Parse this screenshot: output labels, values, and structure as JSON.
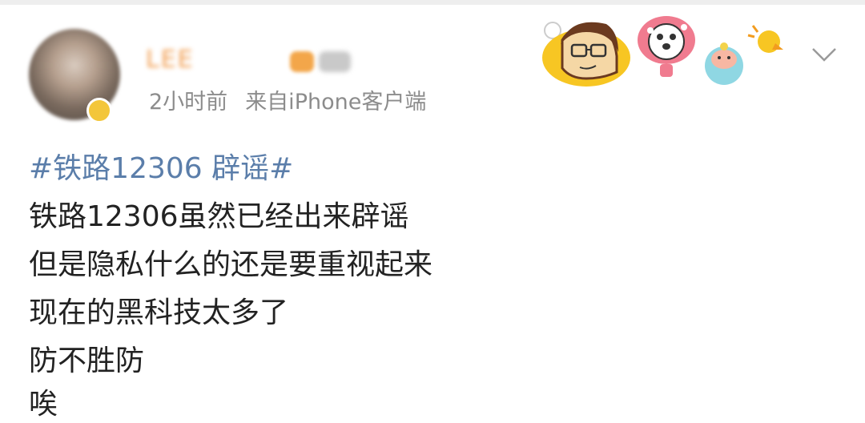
{
  "post": {
    "username": "LEE",
    "time": "2小时前",
    "source": "来自iPhone客户端",
    "topic": "#铁路12306 辟谣#",
    "lines": [
      "铁路12306虽然已经出来辟谣",
      "但是隐私什么的还是要重视起来",
      "现在的黑科技太多了",
      "防不胜防",
      "唉"
    ]
  },
  "icons": {
    "stickers": "cartoon-stickers-icon",
    "chevron": "chevron-down-icon"
  },
  "colors": {
    "topic": "#5b7eaa",
    "meta": "#8c8c8c",
    "text": "#222222",
    "username": "#f19a4a"
  }
}
